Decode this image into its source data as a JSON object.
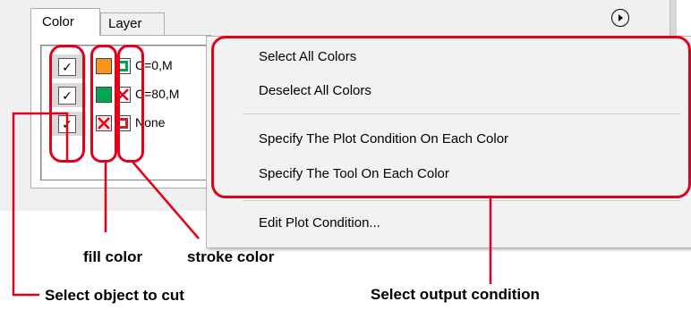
{
  "tabs": [
    {
      "label": "Color"
    },
    {
      "label": "Layer"
    }
  ],
  "panel": {
    "menu_button_icon": "play-circle-icon"
  },
  "color_rows": [
    {
      "checked": true,
      "check_mark": "✓",
      "fill_color": "#f7941d",
      "fill_icon": "filled-swatch",
      "stroke_color": "#00a651",
      "stroke_icon": "outlined-swatch",
      "label": "C=0,M"
    },
    {
      "checked": true,
      "check_mark": "✓",
      "fill_color": "#00a651",
      "fill_icon": "filled-swatch",
      "stroke_color": "#e3001b",
      "stroke_icon": "none-x-swatch",
      "label": "C=80,M"
    },
    {
      "checked": true,
      "check_mark": "✓",
      "fill_color": "#e3001b",
      "fill_icon": "none-x-swatch",
      "stroke_color": "#c1272d",
      "stroke_icon": "outlined-swatch",
      "label": "None"
    }
  ],
  "context_menu": {
    "items": [
      {
        "label": "Select All Colors"
      },
      {
        "label": "Deselect All Colors"
      },
      {
        "label": "Specify The Plot Condition On Each Color"
      },
      {
        "label": "Specify The Tool On Each Color"
      },
      {
        "label": "Edit Plot Condition..."
      }
    ]
  },
  "annotations": {
    "fill_color": "fill color",
    "stroke_color": "stroke color",
    "select_object": "Select object to cut",
    "select_output": "Select output condition"
  },
  "colors": {
    "callout_red": "#e3001b",
    "menu_bg": "#f2f2f2",
    "panel_bg": "#f0f0f0"
  }
}
